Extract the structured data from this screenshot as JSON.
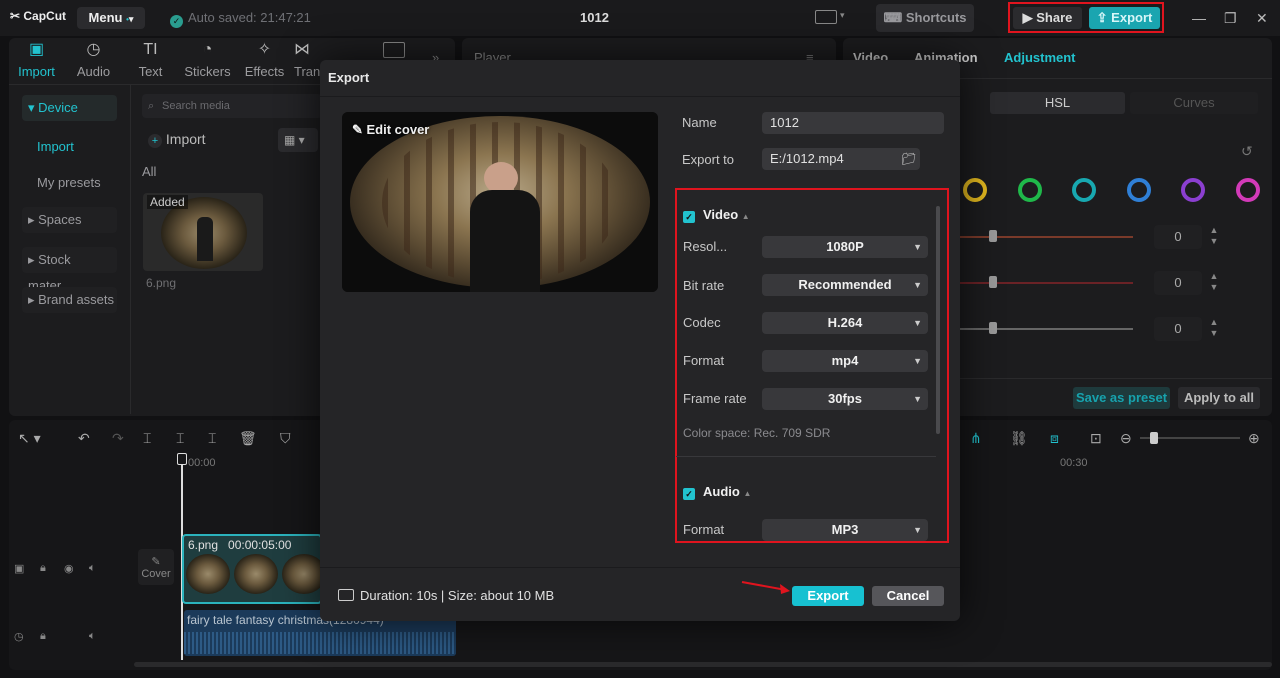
{
  "titlebar": {
    "logo": "CapCut",
    "menu_label": "Menu",
    "autosave": "Auto saved: 21:47:21",
    "project_title": "1012",
    "shortcuts_label": "Shortcuts",
    "share_label": "Share",
    "export_label": "Export"
  },
  "toolbar": {
    "tabs": [
      {
        "label": "Import",
        "icon": "import-icon"
      },
      {
        "label": "Audio",
        "icon": "audio-icon"
      },
      {
        "label": "Text",
        "icon": "text-icon"
      },
      {
        "label": "Stickers",
        "icon": "stickers-icon"
      },
      {
        "label": "Effects",
        "icon": "effects-icon"
      },
      {
        "label": "Tran",
        "icon": "transitions-icon"
      }
    ]
  },
  "sidebar": {
    "items": [
      "Device",
      "Import",
      "My presets",
      "Spaces",
      "Stock mater...",
      "Brand assets"
    ]
  },
  "media": {
    "search_placeholder": "Search media",
    "import_label": "Import",
    "filter_all": "All",
    "thumb_badge": "Added",
    "thumb_name": "6.png"
  },
  "player": {
    "title": "Player"
  },
  "right_panel": {
    "tabs": [
      "Video",
      "Animation",
      "Adjustment"
    ],
    "hsl_label": "HSL",
    "curves_label": "Curves",
    "values": [
      "0",
      "0",
      "0"
    ],
    "save_preset": "Save as preset",
    "apply_all": "Apply to all",
    "hue_colors": [
      "#e2b81f",
      "#1fb84a",
      "#18a8b0",
      "#2f7fd6",
      "#8b3fd0",
      "#d23ab8"
    ]
  },
  "timeline": {
    "start_time": "00:00",
    "mark_time": "00:30",
    "cover_label": "Cover",
    "clip_name": "6.png",
    "clip_duration": "00:00:05:00",
    "audio_name": "fairy tale fantasy christmas(1280944)"
  },
  "modal": {
    "title": "Export",
    "edit_cover": "Edit cover",
    "name_label": "Name",
    "name_value": "1012",
    "export_to_label": "Export to",
    "export_to_value": "E:/1012.mp4",
    "video_section": "Video",
    "resolution_label": "Resol...",
    "resolution_value": "1080P",
    "bitrate_label": "Bit rate",
    "bitrate_value": "Recommended",
    "codec_label": "Codec",
    "codec_value": "H.264",
    "format_label": "Format",
    "format_value": "mp4",
    "framerate_label": "Frame rate",
    "framerate_value": "30fps",
    "color_space": "Color space: Rec. 709 SDR",
    "audio_section": "Audio",
    "audio_format_label": "Format",
    "audio_format_value": "MP3",
    "duration_size": "Duration: 10s | Size: about 10 MB",
    "export_button": "Export",
    "cancel_button": "Cancel"
  },
  "colors": {
    "accent": "#22c3cf",
    "highlight_red": "#e0141e"
  }
}
